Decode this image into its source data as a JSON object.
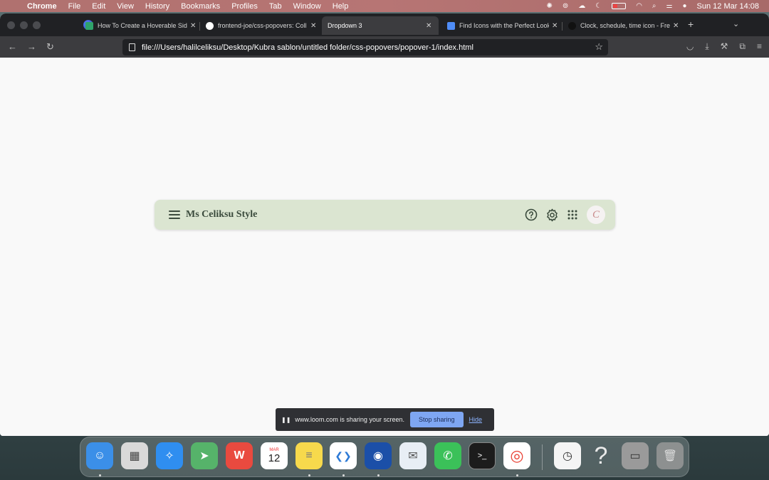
{
  "menubar": {
    "app_name": "Chrome",
    "items": [
      "File",
      "Edit",
      "View",
      "History",
      "Bookmarks",
      "Profiles",
      "Tab",
      "Window",
      "Help"
    ],
    "clock": "Sun 12 Mar  14:08"
  },
  "tabs": [
    {
      "title": "How To Create a Hoverable Side",
      "favicon": "w-logo-icon",
      "color": "#2fa36b"
    },
    {
      "title": "frontend-joe/css-popovers: Coll",
      "favicon": "github-icon",
      "color": "#ffffff"
    },
    {
      "title": "Dropdown 3",
      "favicon": "",
      "color": "",
      "active": true
    },
    {
      "title": "Find Icons with the Perfect Look",
      "favicon": "flag-icon",
      "color": "#4f8df7"
    },
    {
      "title": "Clock, schedule, time icon - Free",
      "favicon": "dark-circle-icon",
      "color": "#111111"
    }
  ],
  "address": {
    "url": "file:///Users/halilceliksu/Desktop/Kubra sablon/untitled folder/css-popovers/popover-1/index.html"
  },
  "navbar": {
    "brand": "Ms Celiksu Style",
    "avatar_letter": "C",
    "bg_color": "#dbe5d1"
  },
  "share_bar": {
    "message": "www.loom.com is sharing your screen.",
    "stop_label": "Stop sharing",
    "hide_label": "Hide"
  },
  "dock": {
    "apps": [
      {
        "name": "finder",
        "color": "#3b8fe8",
        "glyph": "☺"
      },
      {
        "name": "launchpad",
        "color": "#d9d9d9",
        "glyph": "▦"
      },
      {
        "name": "safari",
        "color": "#2f8ef0",
        "glyph": "✧"
      },
      {
        "name": "maps",
        "color": "#56b36a",
        "glyph": "➤"
      },
      {
        "name": "wps-office",
        "color": "#e94a3f",
        "glyph": "W"
      },
      {
        "name": "calendar",
        "color": "#ffffff",
        "glyph": "12"
      },
      {
        "name": "notes",
        "color": "#f7d94c",
        "glyph": "≡"
      },
      {
        "name": "vscode",
        "color": "#2d7ad6",
        "glyph": "❮❯"
      },
      {
        "name": "firefox-dev",
        "color": "#1b4fa8",
        "glyph": "◉"
      },
      {
        "name": "mail",
        "color": "#e8eef5",
        "glyph": "✉"
      },
      {
        "name": "whatsapp",
        "color": "#3bc159",
        "glyph": "✆"
      },
      {
        "name": "terminal",
        "color": "#1c1c1c",
        "glyph": ">_"
      },
      {
        "name": "chrome",
        "color": "#e94235",
        "glyph": "◎"
      },
      {
        "name": "file-clock",
        "color": "#f4f4f4",
        "glyph": "◷"
      },
      {
        "name": "help",
        "color": "transparent",
        "glyph": "?"
      },
      {
        "name": "disk",
        "color": "#9a9a9a",
        "glyph": "▭"
      },
      {
        "name": "trash",
        "color": "#8d9090",
        "glyph": "🗑"
      }
    ],
    "calendar_month": "MAR",
    "calendar_day": "12"
  }
}
